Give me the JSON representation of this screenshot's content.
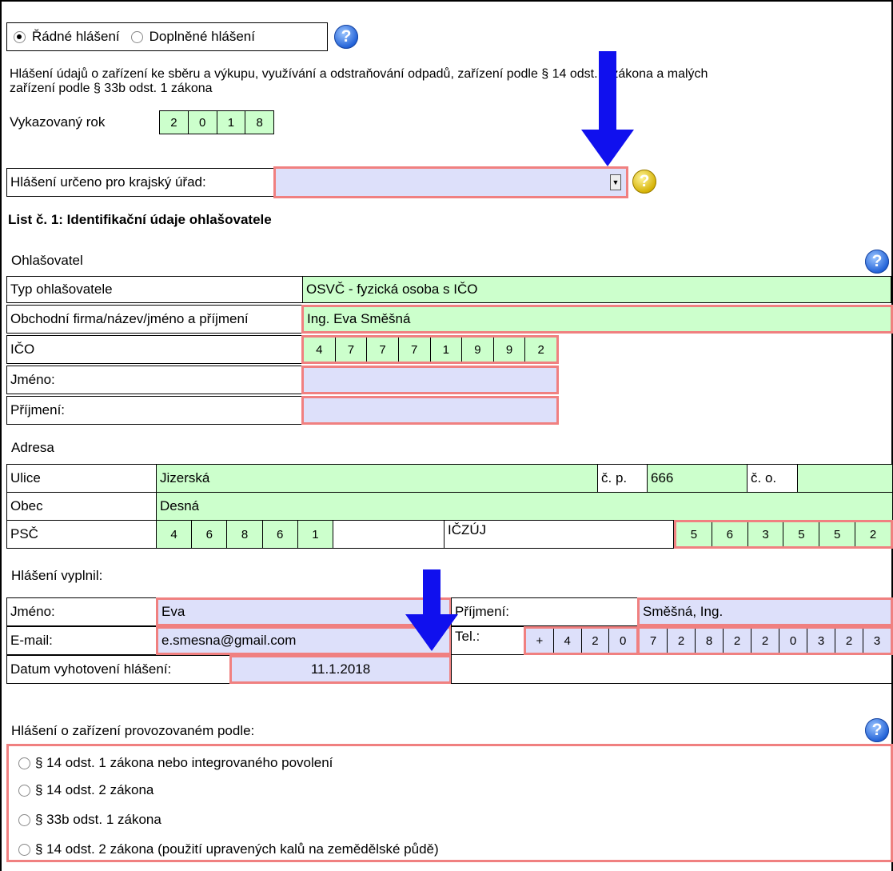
{
  "report_type": {
    "options": [
      "Řádné hlášení",
      "Doplněné hlášení"
    ],
    "selected": 0
  },
  "intro_text_line1": "Hlášení údajů o zařízení ke sběru a výkupu, využívání a odstraňování odpadů, zařízení podle § 14 odst. 2 zákona a malých",
  "intro_text_line2": "zařízení podle § 33b odst. 1 zákona",
  "year": {
    "label": "Vykazovaný rok",
    "digits": [
      "2",
      "0",
      "1",
      "8"
    ]
  },
  "region": {
    "label": "Hlášení určeno pro krajský úřad:",
    "value": ""
  },
  "sheet_title": "List č. 1: Identifikační údaje ohlašovatele",
  "reporter": {
    "section_label": "Ohlašovatel",
    "type_label": "Typ ohlašovatele",
    "type_value": "OSVČ - fyzická osoba s IČO",
    "name_label": "Obchodní firma/název/jméno a příjmení",
    "name_value": "Ing. Eva Směšná",
    "ico_label": "IČO",
    "ico_digits": [
      "4",
      "7",
      "7",
      "7",
      "1",
      "9",
      "9",
      "2"
    ],
    "first_name_label": "Jméno:",
    "first_name_value": "",
    "surname_label": "Příjmení:",
    "surname_value": ""
  },
  "address": {
    "section_label": "Adresa",
    "street_label": "Ulice",
    "street_value": "Jizerská",
    "cp_label": "č. p.",
    "cp_value": "666",
    "co_label": "č. o.",
    "co_value": "",
    "city_label": "Obec",
    "city_value": "Desná",
    "zip_label": "PSČ",
    "zip_digits": [
      "4",
      "6",
      "8",
      "6",
      "1"
    ],
    "iczuj_label": "IČZÚJ",
    "iczuj_digits": [
      "5",
      "6",
      "3",
      "5",
      "5",
      "2"
    ]
  },
  "filled_by": {
    "section_label": "Hlášení vyplnil:",
    "first_name_label": "Jméno:",
    "first_name_value": "Eva",
    "surname_label": "Příjmení:",
    "surname_value": "Směšná, Ing.",
    "email_label": "E-mail:",
    "email_value": "e.smesna@gmail.com",
    "tel_label": "Tel.:",
    "tel_digits": [
      "+",
      "4",
      "2",
      "0",
      "7",
      "2",
      "8",
      "2",
      "2",
      "0",
      "3",
      "2",
      "3"
    ],
    "date_label": "Datum vyhotovení hlášení:",
    "date_value": "11.1.2018"
  },
  "facility": {
    "section_label": "Hlášení o zařízení provozovaném podle:",
    "options": [
      "§ 14 odst. 1 zákona nebo integrovaného povolení",
      "§ 14 odst. 2 zákona",
      "§ 33b odst. 1 zákona",
      "§ 14 odst. 2 zákona (použití upravených kalů na zemědělské půdě)"
    ]
  },
  "colors": {
    "filled": "#ccffcc",
    "empty_field": "#dde0fa",
    "required_border": "#f08080",
    "arrow": "#1010ee"
  },
  "icons": {
    "help": "help-question-icon",
    "warning_help": "yellow-help-icon",
    "arrow": "down-arrow-icon"
  }
}
